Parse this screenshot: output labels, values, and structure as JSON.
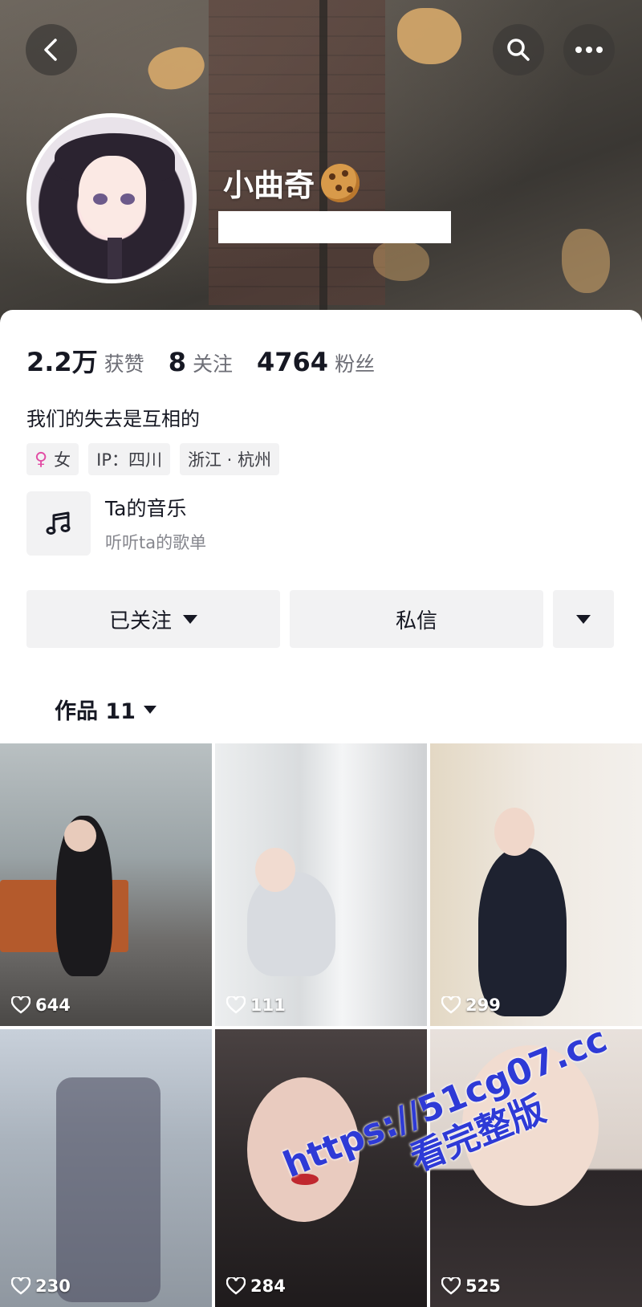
{
  "profile": {
    "nickname": "小曲奇",
    "bio": "我们的失去是互相的",
    "stats": [
      {
        "value": "2.2万",
        "label": "获赞"
      },
      {
        "value": "8",
        "label": "关注"
      },
      {
        "value": "4764",
        "label": "粉丝"
      }
    ],
    "tags": {
      "gender_icon": "female-icon",
      "gender": "女",
      "ip": "IP：四川",
      "location": "浙江 · 杭州"
    }
  },
  "music": {
    "icon": "music-note-icon",
    "title": "Ta的音乐",
    "subtitle": "听听ta的歌单"
  },
  "actions": {
    "follow_label": "已关注",
    "message_label": "私信"
  },
  "works": {
    "tab_label": "作品 11",
    "items": [
      {
        "likes": "644"
      },
      {
        "likes": "111"
      },
      {
        "likes": "299"
      },
      {
        "likes": "230"
      },
      {
        "likes": "284"
      },
      {
        "likes": "525"
      }
    ]
  },
  "watermark": {
    "line1": "https://51cg07.cc",
    "line2": "看完整版"
  },
  "colors": {
    "accent_female": "#e24ea5",
    "watermark": "#2e3ad6",
    "button_bg": "#f2f2f3"
  }
}
